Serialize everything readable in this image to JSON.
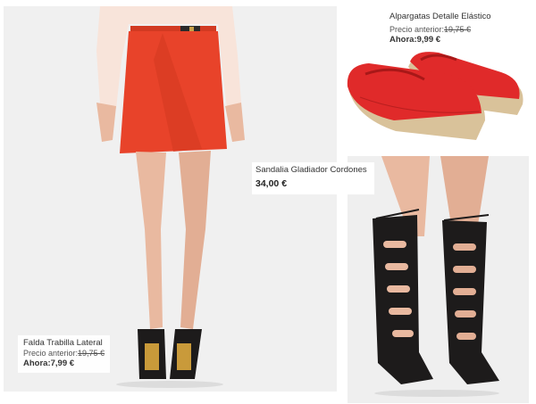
{
  "products": [
    {
      "name": "Falda Trabilla Lateral",
      "previous_label": "Precio anterior:",
      "previous_price": "19,75 €",
      "now_label": "Ahora:",
      "now_price": "7,99 €",
      "image_icon": "red-wrap-skirt-photo"
    },
    {
      "name": "Alpargatas Detalle Elástico",
      "previous_label": "Precio anterior:",
      "previous_price": "19,75 €",
      "now_label": "Ahora:",
      "now_price": "9,99 €",
      "image_icon": "red-espadrilles-photo"
    },
    {
      "name": "Sandalia Gladiador Cordones",
      "price": "34,00 €",
      "image_icon": "black-gladiator-sandals-photo"
    }
  ],
  "colors": {
    "skirt_red": "#e8432a",
    "espadrille_red": "#e02a2a",
    "sandal_black": "#1d1b1b",
    "skin": "#e9b9a0",
    "blouse": "#f8e4da",
    "jute": "#d9c29a"
  }
}
